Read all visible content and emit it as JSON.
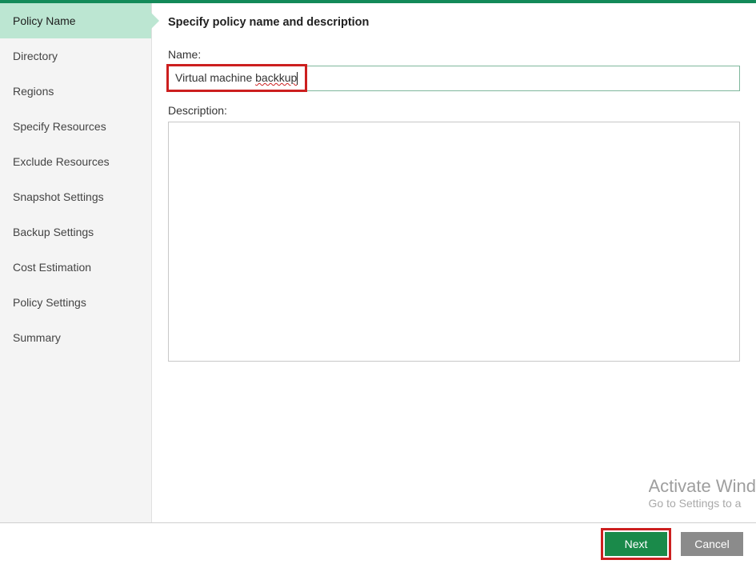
{
  "sidebar": {
    "items": [
      {
        "label": "Policy Name",
        "active": true
      },
      {
        "label": "Directory",
        "active": false
      },
      {
        "label": "Regions",
        "active": false
      },
      {
        "label": "Specify Resources",
        "active": false
      },
      {
        "label": "Exclude Resources",
        "active": false
      },
      {
        "label": "Snapshot Settings",
        "active": false
      },
      {
        "label": "Backup Settings",
        "active": false
      },
      {
        "label": "Cost Estimation",
        "active": false
      },
      {
        "label": "Policy Settings",
        "active": false
      },
      {
        "label": "Summary",
        "active": false
      }
    ]
  },
  "main": {
    "title": "Specify policy name and description",
    "name_label": "Name:",
    "name_value_prefix": "Virtual machine ",
    "name_value_misspelled": "backkup",
    "desc_label": "Description:",
    "desc_value": ""
  },
  "watermark": {
    "line1": "Activate Wind",
    "line2": "Go to Settings to a"
  },
  "footer": {
    "next": "Next",
    "cancel": "Cancel"
  }
}
